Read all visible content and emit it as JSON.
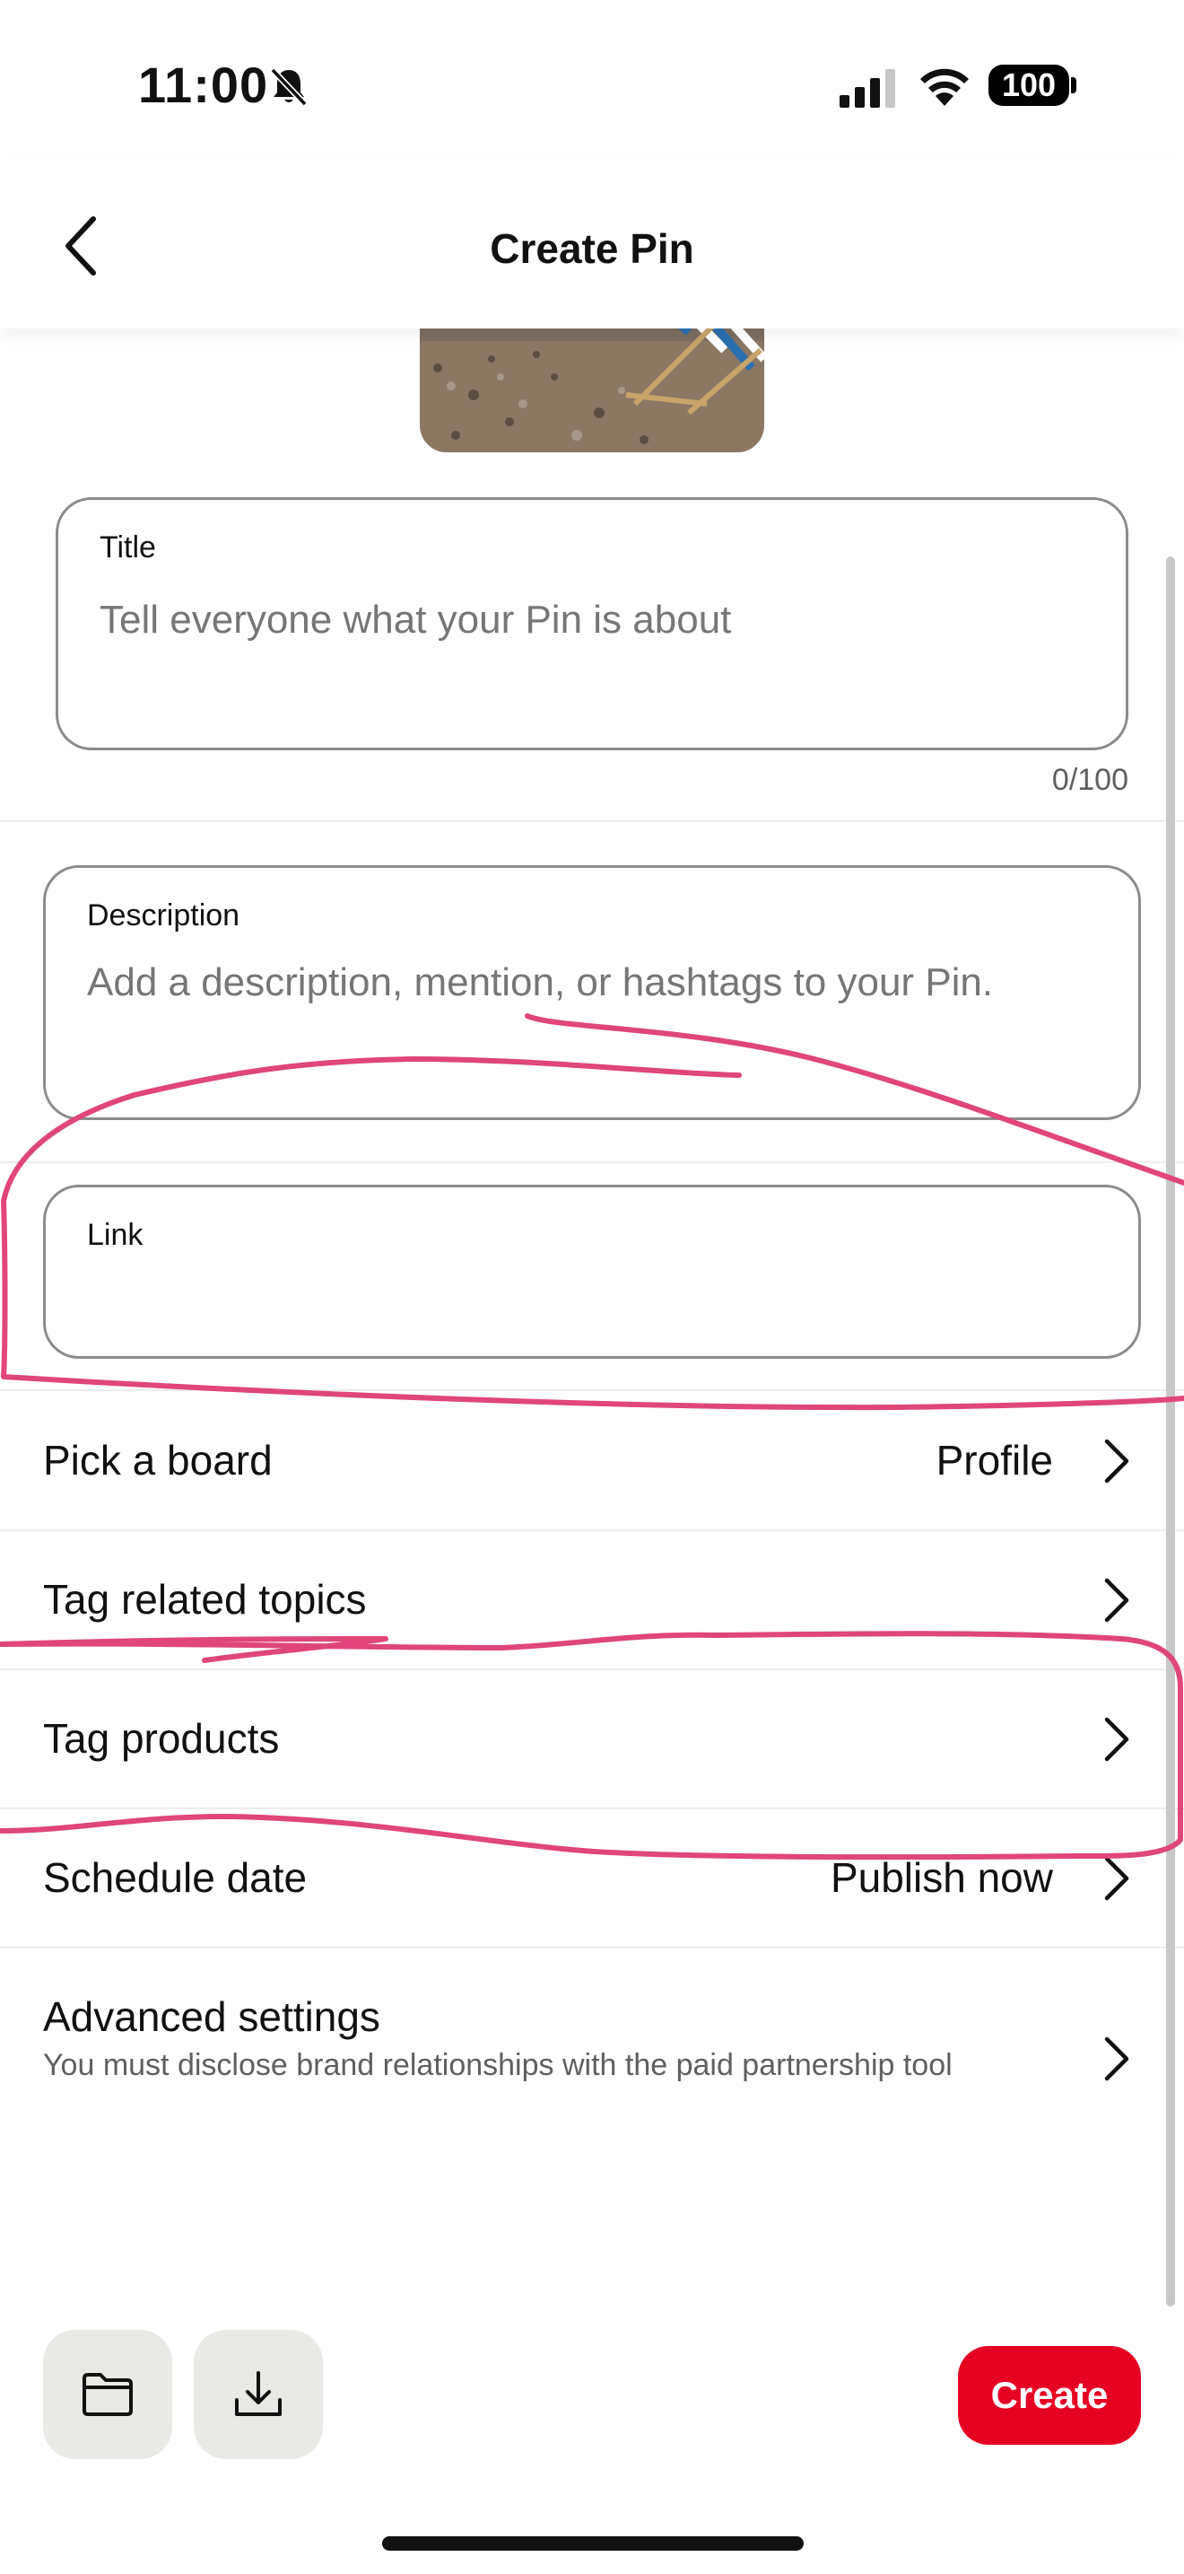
{
  "status_bar": {
    "time": "11:00",
    "battery": "100",
    "icons": [
      "bell-muted-icon",
      "signal-icon",
      "wifi-icon",
      "battery-icon"
    ]
  },
  "header": {
    "title": "Create Pin",
    "back_icon": "chevron-left-icon"
  },
  "form": {
    "title_field": {
      "label": "Title",
      "value": "",
      "placeholder": "Tell everyone what your Pin is about",
      "counter": "0/100"
    },
    "description_field": {
      "label": "Description",
      "value": "",
      "placeholder": "Add a description, mention, or hashtags to your Pin."
    },
    "link_field": {
      "label": "Link",
      "value": ""
    }
  },
  "rows": [
    {
      "label": "Pick a board",
      "value": "Profile"
    },
    {
      "label": "Tag related topics",
      "value": ""
    },
    {
      "label": "Tag products",
      "value": ""
    },
    {
      "label": "Schedule date",
      "value": "Publish now"
    },
    {
      "label": "Advanced settings",
      "value": "",
      "sub": "You must disclose brand relationships with the paid partnership tool"
    }
  ],
  "toolbar": {
    "folder_icon": "folder-icon",
    "download_icon": "download-icon",
    "create_label": "Create"
  },
  "colors": {
    "accent": "#e60023",
    "annotation_ink": "#e0457b",
    "tool_button_bg": "#e9e9e5"
  }
}
